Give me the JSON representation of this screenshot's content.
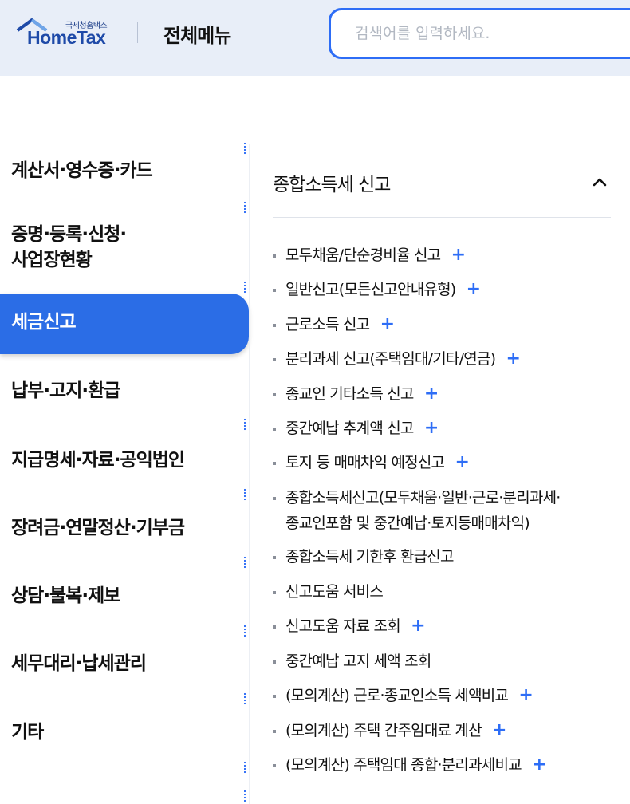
{
  "header": {
    "logo_sub": "국세청홈택스",
    "logo_main": "HomeTax",
    "title": "전체메뉴",
    "search_placeholder": "검색어를 입력하세요."
  },
  "left_menu": [
    {
      "label": "계산서·영수증·카드",
      "active": false
    },
    {
      "label": "증명·등록·신청·",
      "label2": "사업장현황",
      "active": false
    },
    {
      "label": "세금신고",
      "active": true
    },
    {
      "label": "납부·고지·환급",
      "active": false
    },
    {
      "label": "지급명세·자료·공익법인",
      "active": false
    },
    {
      "label": "장려금·연말정산·기부금",
      "active": false
    },
    {
      "label": "상담·불복·제보",
      "active": false
    },
    {
      "label": "세무대리·납세관리",
      "active": false
    },
    {
      "label": "기타",
      "active": false
    }
  ],
  "section": {
    "title": "종합소득세 신고",
    "expanded": true,
    "items": [
      {
        "label": "모두채움/단순경비율 신고",
        "expandable": true
      },
      {
        "label": "일반신고(모든신고안내유형)",
        "expandable": true
      },
      {
        "label": "근로소득 신고",
        "expandable": true
      },
      {
        "label": "분리과세 신고(주택임대/기타/연금)",
        "expandable": true
      },
      {
        "label": "종교인 기타소득 신고",
        "expandable": true
      },
      {
        "label": "중간예납 추계액 신고",
        "expandable": true
      },
      {
        "label": "토지 등 매매차익 예정신고",
        "expandable": true
      },
      {
        "label": "종합소득세신고(모두채움·일반·근로·분리과세·",
        "label2": "종교인포함 및 중간예납·토지등매매차익)",
        "expandable": false
      },
      {
        "label": "종합소득세 기한후 환급신고",
        "expandable": false
      },
      {
        "label": "신고도움 서비스",
        "expandable": false
      },
      {
        "label": "신고도움 자료 조회",
        "expandable": true
      },
      {
        "label": "중간예납 고지 세액 조회",
        "expandable": false
      },
      {
        "label": "(모의계산) 근로·종교인소득 세액비교",
        "expandable": true
      },
      {
        "label": "(모의계산) 주택 간주임대료 계산",
        "expandable": true
      },
      {
        "label": "(모의계산) 주택임대 종합·분리과세비교",
        "expandable": true
      }
    ]
  },
  "plus_symbol": "+",
  "colors": {
    "accent": "#2b6de6",
    "header_bg": "#e8eef8",
    "brand": "#1e4aa8"
  }
}
